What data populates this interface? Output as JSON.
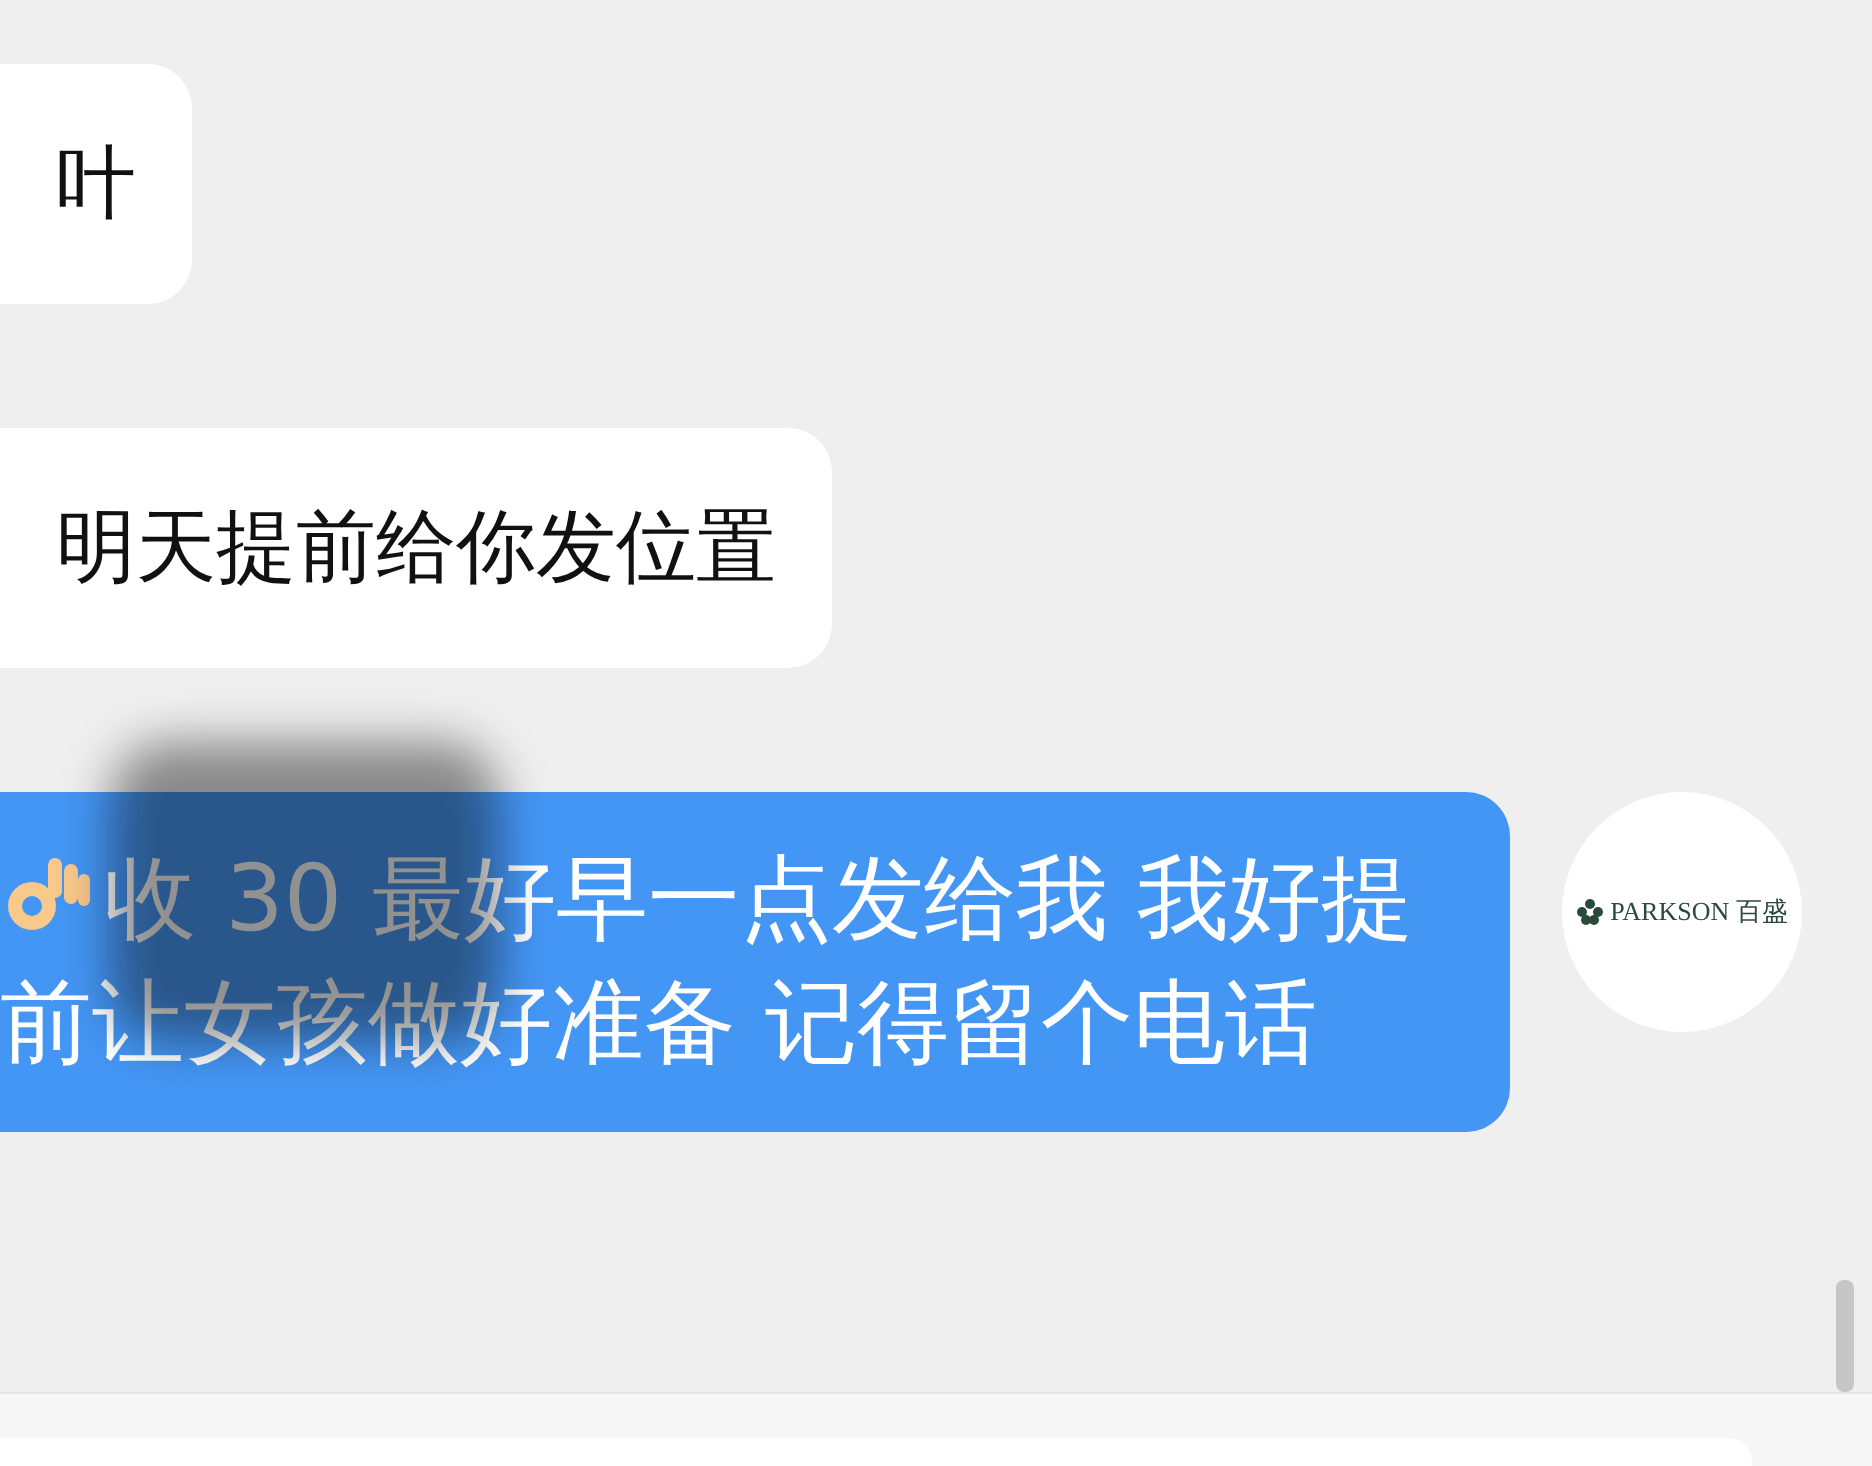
{
  "messages": [
    {
      "kind": "incoming",
      "text": "叶"
    },
    {
      "kind": "incoming",
      "text": "明天提前给你发位置"
    },
    {
      "kind": "outgoing",
      "emoji": true,
      "redacted": true,
      "text": "收 30 最好早一点发给我 我好提前让女孩做好准备 记得留个电话",
      "avatar": {
        "brand": "PARKSON",
        "brand_cn": "百盛"
      }
    }
  ]
}
